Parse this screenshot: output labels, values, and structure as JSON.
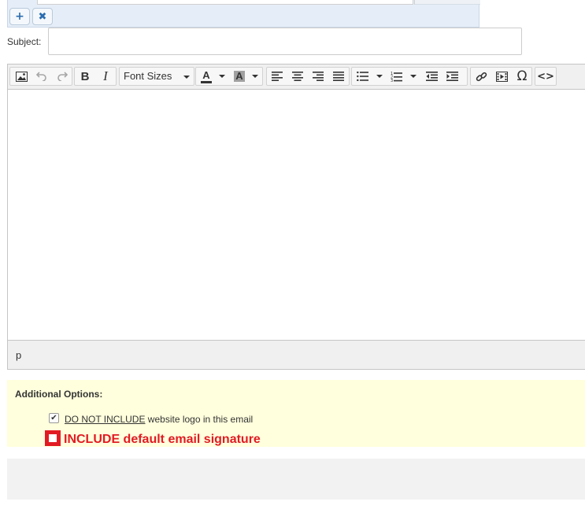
{
  "recipients": {
    "add_label": "+",
    "remove_label": "✖"
  },
  "subject": {
    "label": "Subject:",
    "value": "",
    "placeholder": ""
  },
  "toolbar": {
    "bold": "B",
    "italic": "I",
    "font_sizes": "Font Sizes",
    "text_color": "A",
    "bg_color": "A",
    "special_char": "Ω",
    "source_code": "<>"
  },
  "editor": {
    "content": "",
    "path": "p"
  },
  "options": {
    "title": "Additional Options:",
    "logo_emphasis": "DO NOT INCLUDE",
    "logo_rest": " website logo in this email",
    "logo_checked": true,
    "signature_label": "INCLUDE default email signature",
    "signature_checked": false
  },
  "colors": {
    "accent": "#2b6cb0",
    "highlight": "#e21b23",
    "options_bg": "#ffffdd"
  }
}
